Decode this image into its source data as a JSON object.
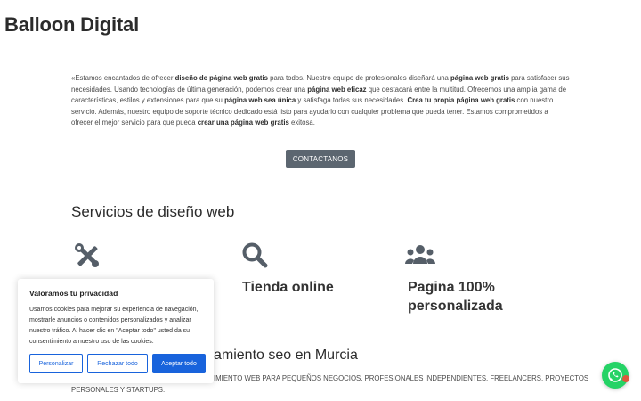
{
  "site": {
    "title": "Balloon Digital"
  },
  "intro": {
    "segments": [
      {
        "t": "«Estamos encantados de ofrecer ",
        "b": false
      },
      {
        "t": "diseño de página web gratis",
        "b": true
      },
      {
        "t": " para todos. Nuestro equipo de profesionales diseñará una ",
        "b": false
      },
      {
        "t": "página web gratis",
        "b": true
      },
      {
        "t": " para satisfacer sus necesidades. Usando tecnologías de última generación, podemos crear una ",
        "b": false
      },
      {
        "t": "página web eficaz",
        "b": true
      },
      {
        "t": " que destacará entre la multitud. Ofrecemos una amplia gama de características, estilos y extensiones para que su ",
        "b": false
      },
      {
        "t": "página web sea única",
        "b": true
      },
      {
        "t": " y satisfaga todas sus necesidades. ",
        "b": false
      },
      {
        "t": "Crea tu propia página web gratis",
        "b": true
      },
      {
        "t": " con nuestro servicio. Además, nuestro equipo de soporte técnico dedicado está listo para ayudarlo con cualquier problema que pueda tener. Estamos comprometidos a ofrecer el mejor servicio para que pueda ",
        "b": false
      },
      {
        "t": "crear una página web gratis",
        "b": true
      },
      {
        "t": " exitosa.",
        "b": false
      }
    ]
  },
  "contact_button": {
    "label": "CONTACTANOS"
  },
  "services": {
    "heading": "Servicios de diseño web",
    "items": [
      {
        "icon": "tools-icon",
        "title": ""
      },
      {
        "icon": "search-icon",
        "title": "Tienda online"
      },
      {
        "icon": "users-icon",
        "title": "Pagina 100% personalizada"
      }
    ]
  },
  "seo": {
    "heading": "amiento seo en Murcia",
    "text_left": "PERSONALES Y STARTUPS.",
    "text_right": "IMIENTO WEB PARA PEQUEÑOS NEGOCIOS, PROFESIONALES INDEPENDIENTES, FREELANCERS, PROYECTOS"
  },
  "cookie_banner": {
    "title": "Valoramos tu privacidad",
    "text": "Usamos cookies para mejorar su experiencia de navegación, mostrarle anuncios o contenidos personalizados y analizar nuestro tráfico. Al hacer clic en \"Aceptar todo\" usted da su consentimiento a nuestro uso de las cookies.",
    "buttons": {
      "customize": "Personalizar",
      "reject": "Rechazar todo",
      "accept": "Aceptar todo"
    }
  },
  "whatsapp": {
    "icon": "whatsapp-icon"
  },
  "colors": {
    "accent": "#1863dc",
    "button_gray": "#5c6670",
    "whatsapp": "#25d366",
    "icons": "#555e68"
  }
}
